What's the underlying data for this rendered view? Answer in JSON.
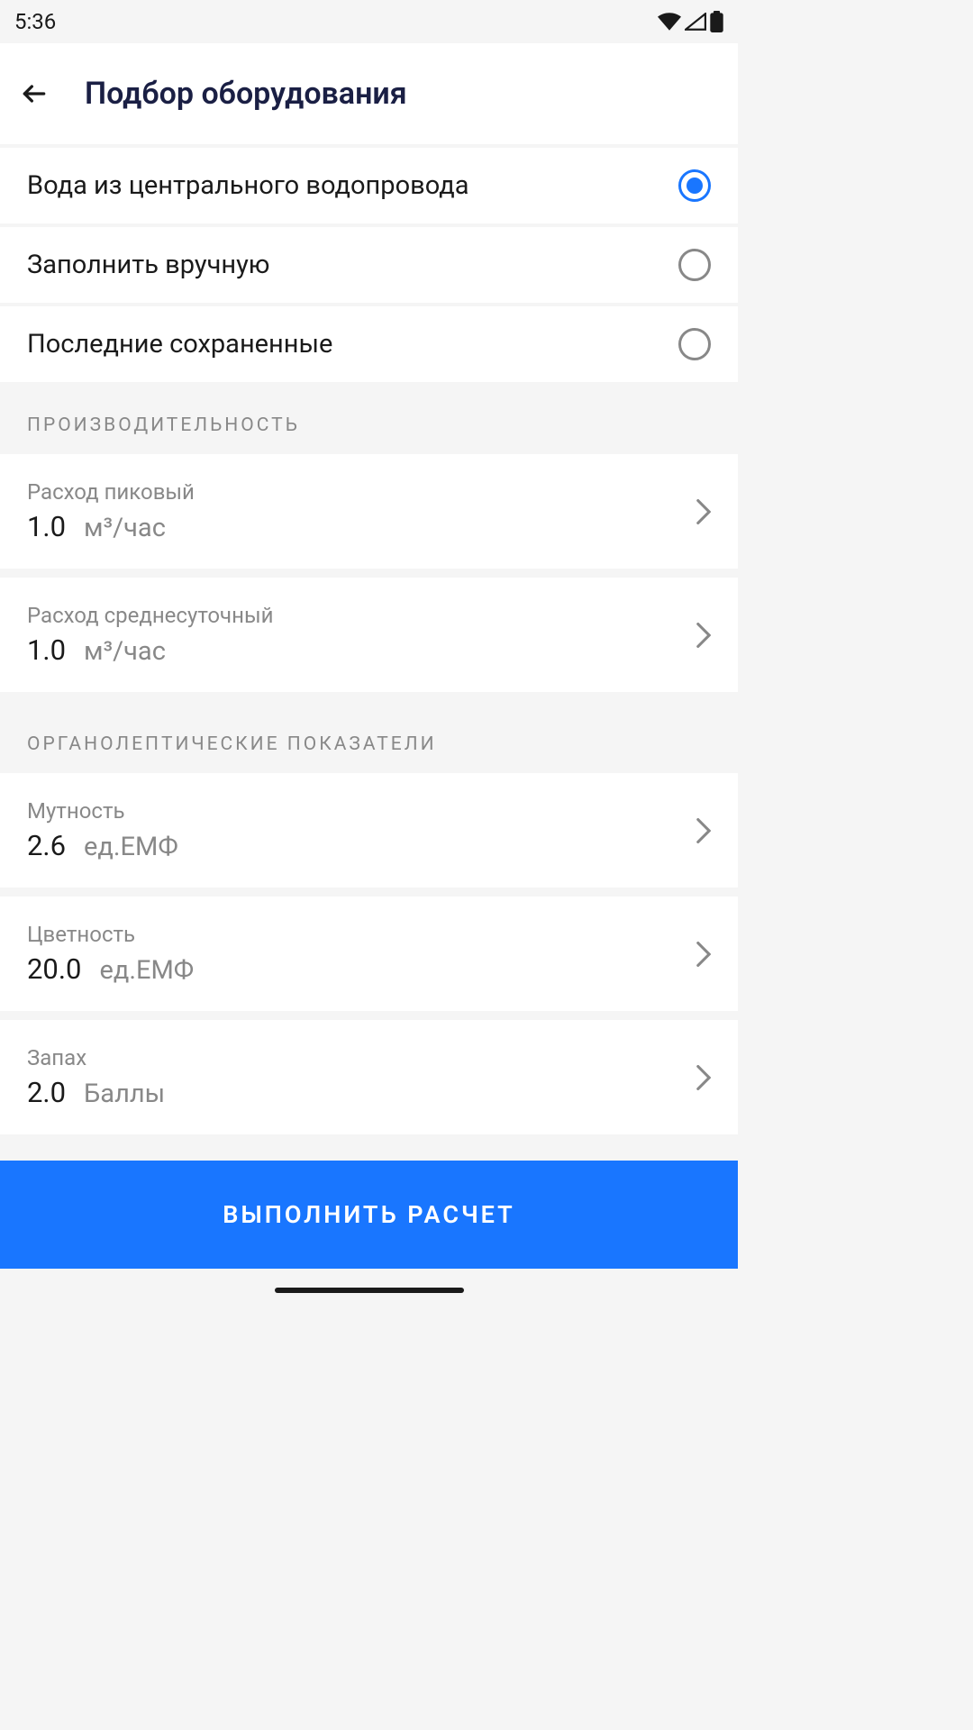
{
  "status": {
    "time": "5:36"
  },
  "header": {
    "title": "Подбор оборудования"
  },
  "radios": [
    {
      "label": "Вода из центрального водопровода",
      "selected": true
    },
    {
      "label": "Заполнить вручную",
      "selected": false
    },
    {
      "label": "Последние сохраненные",
      "selected": false
    }
  ],
  "sections": {
    "performance": {
      "title": "ПРОИЗВОДИТЕЛЬНОСТЬ",
      "params": [
        {
          "label": "Расход пиковый",
          "value": "1.0",
          "unit": "м³/час"
        },
        {
          "label": "Расход среднесуточный",
          "value": "1.0",
          "unit": "м³/час"
        }
      ]
    },
    "organoleptic": {
      "title": "ОРГАНОЛЕПТИЧЕСКИЕ ПОКАЗАТЕЛИ",
      "params": [
        {
          "label": "Мутность",
          "value": "2.6",
          "unit": "ед.ЕМФ"
        },
        {
          "label": "Цветность",
          "value": "20.0",
          "unit": "ед.ЕМФ"
        },
        {
          "label": "Запах",
          "value": "2.0",
          "unit": "Баллы"
        }
      ]
    }
  },
  "button": {
    "label": "ВЫПОЛНИТЬ РАСЧЕТ"
  }
}
